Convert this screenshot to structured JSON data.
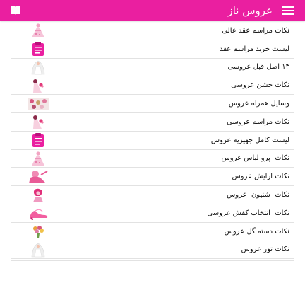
{
  "app": {
    "title": "عروس ناز",
    "accent": "#ea1fa0"
  },
  "items": [
    {
      "label": "نکات مراسم عقد عالی",
      "icon": "bride-dress-icon"
    },
    {
      "label": "لیست خرید مراسم عقد",
      "icon": "clipboard-icon"
    },
    {
      "label": "۱۳ اصل قبل عروسی",
      "icon": "bride-veil-icon"
    },
    {
      "label": "نکات جشن عروسی",
      "icon": "bride-bouquet-icon"
    },
    {
      "label": "وسایل همراه عروس",
      "icon": "wedding-items-icon"
    },
    {
      "label": "نکات مراسم عروسی",
      "icon": "bride-bouquet-icon"
    },
    {
      "label": "لیست کامل جهیزیه عروس",
      "icon": "clipboard-icon"
    },
    {
      "label": "نکات  پرو لباس عروس",
      "icon": "bride-dress-icon"
    },
    {
      "label": "نکات ارایش عروس",
      "icon": "bride-makeup-icon"
    },
    {
      "label": "نکات  شنیون  عروس",
      "icon": "bride-hair-icon"
    },
    {
      "label": "نکات  انتخاب کفش عروسی",
      "icon": "high-heel-shoe-icon"
    },
    {
      "label": "نکات دسته گل عروس",
      "icon": "flower-bouquet-icon"
    },
    {
      "label": "نکات تور عروس",
      "icon": "bride-veil-icon"
    }
  ]
}
